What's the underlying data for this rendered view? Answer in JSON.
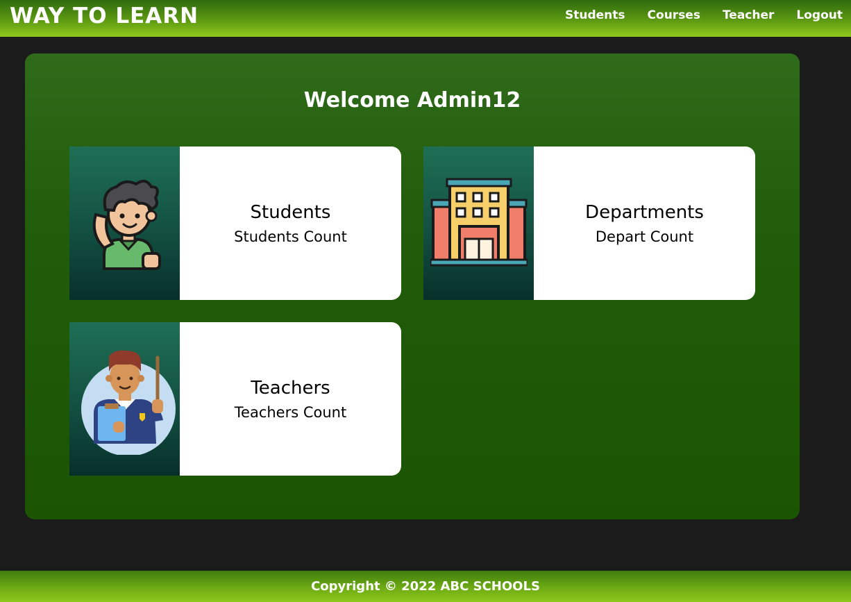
{
  "navbar": {
    "brand": "WAY TO LEARN",
    "links": [
      {
        "label": "Students"
      },
      {
        "label": "Courses"
      },
      {
        "label": "Teacher"
      },
      {
        "label": "Logout"
      }
    ]
  },
  "main": {
    "welcome": "Welcome Admin12",
    "cards": [
      {
        "title": "Students",
        "subtitle": "Students Count",
        "icon": "student-icon"
      },
      {
        "title": "Departments",
        "subtitle": "Depart Count",
        "icon": "building-icon"
      },
      {
        "title": "Teachers",
        "subtitle": "Teachers Count",
        "icon": "teacher-icon"
      }
    ]
  },
  "footer": {
    "copyright": "Copyright © 2022 ABC SCHOOLS"
  },
  "colors": {
    "page_bg": "#1b1b1b",
    "bar_green": "#8fc81c",
    "panel_green": "#215d0a",
    "card_image_bg": "#135042"
  }
}
